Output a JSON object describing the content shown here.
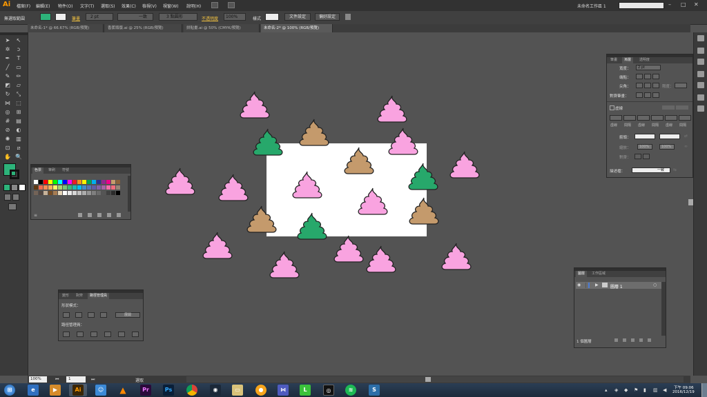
{
  "app": {
    "logo": "Ai",
    "window_title": "未命名工作區 1",
    "search_placeholder": ""
  },
  "menu": [
    "檔案(F)",
    "編輯(E)",
    "物件(O)",
    "文字(T)",
    "選取(S)",
    "效果(C)",
    "檢視(V)",
    "視窗(W)",
    "說明(H)"
  ],
  "control_bar": {
    "selection_label": "無選取範圍",
    "stroke_label": "筆畫",
    "stroke_weight": "2 pt",
    "stroke_profile": "一致",
    "brush": "3 點圓形",
    "opacity_label": "不透明度",
    "opacity_value": "100%",
    "style_label": "樣式",
    "doc_setup": "文件設定",
    "prefs": "偏好設定"
  },
  "doc_tabs": [
    "未命名-1* @ 66.67% (RGB/預覽)",
    "香蕉頭版.ai @ 25% (RGB/預覽)",
    "拼貼畫.ai @ 50% (CMYK/預覽)",
    "未命名-2* @ 100% (RGB/預覽)"
  ],
  "swatches_panel": {
    "tabs": [
      "色票",
      "筆刷",
      "符號"
    ],
    "colors": [
      "#ffffff",
      "#000000",
      "#ff0000",
      "#ffff00",
      "#00ff00",
      "#00ffff",
      "#0000ff",
      "#ff00ff",
      "#ed1c24",
      "#f7941d",
      "#fff200",
      "#00a651",
      "#00aeef",
      "#2e3192",
      "#92278f",
      "#ec008c",
      "#c69c6d",
      "#8c6239",
      "#603913",
      "#f26c4f",
      "#f68e56",
      "#fbaf5d",
      "#fff568",
      "#acd373",
      "#7cc576",
      "#3bb878",
      "#1abbb4",
      "#00bff3",
      "#438ccb",
      "#5574b9",
      "#605ca8",
      "#855fa8",
      "#a763a8",
      "#f06ea9",
      "#f26d7d",
      "#998675",
      "#736357",
      "#534741",
      "#c7b299",
      "#754c24",
      "#a67c52",
      "#e6d6b8",
      "#ffffff",
      "#ebebeb",
      "#d7d7d7",
      "#c2c2c2",
      "#adadad",
      "#959595",
      "#808080",
      "#6b6b6b",
      "#555555",
      "#404040",
      "#2b2b2b",
      "#000000"
    ]
  },
  "pathfinder_panel": {
    "tabs": [
      "變形",
      "對齊",
      "路徑管理員"
    ],
    "shape_modes_label": "形狀模式：",
    "expand_button": "展開",
    "pathfinders_label": "路徑管理員："
  },
  "stroke_panel": {
    "tabs": [
      "筆畫",
      "漸層",
      "透明度"
    ],
    "weight_label": "寬度：",
    "weight_value": "2 pt",
    "cap_label": "端點：",
    "corner_label": "尖角：",
    "limit_label": "限度：",
    "align_label": "對齊筆畫：",
    "dashed_label": "虛線",
    "dash_labels": [
      "虛線",
      "間隔",
      "虛線",
      "間隔",
      "虛線",
      "間隔"
    ],
    "arrow_label": "箭頭：",
    "scale_label": "縮放：",
    "scale_values": [
      "100%",
      "100%"
    ],
    "align_arrow_label": "對齊：",
    "profile_label": "描述檔：",
    "profile_value": "一致"
  },
  "layers_panel": {
    "tabs": [
      "圖層",
      "工作區域"
    ],
    "layer_name": "圖層 1",
    "footer_count": "1 個圖層"
  },
  "status_bar": {
    "zoom": "100%",
    "page": "1",
    "tool": "選取"
  },
  "taskbar": {
    "time": "下午 09:06",
    "date": "2016/12/19"
  },
  "colors": {
    "pink": "#f9a3e0",
    "brown": "#c49a6c",
    "green": "#27a86b",
    "fill_swatch": "#2db37a"
  },
  "poops": [
    {
      "color": "pink"
    },
    {
      "color": "pink"
    },
    {
      "color": "green"
    },
    {
      "color": "brown"
    },
    {
      "color": "pink"
    },
    {
      "color": "brown"
    },
    {
      "color": "green"
    },
    {
      "color": "pink"
    },
    {
      "color": "pink"
    },
    {
      "color": "pink"
    },
    {
      "color": "pink"
    },
    {
      "color": "brown"
    },
    {
      "color": "brown"
    },
    {
      "color": "green"
    },
    {
      "color": "pink"
    },
    {
      "color": "pink"
    },
    {
      "color": "pink"
    },
    {
      "color": "pink"
    },
    {
      "color": "pink"
    }
  ]
}
